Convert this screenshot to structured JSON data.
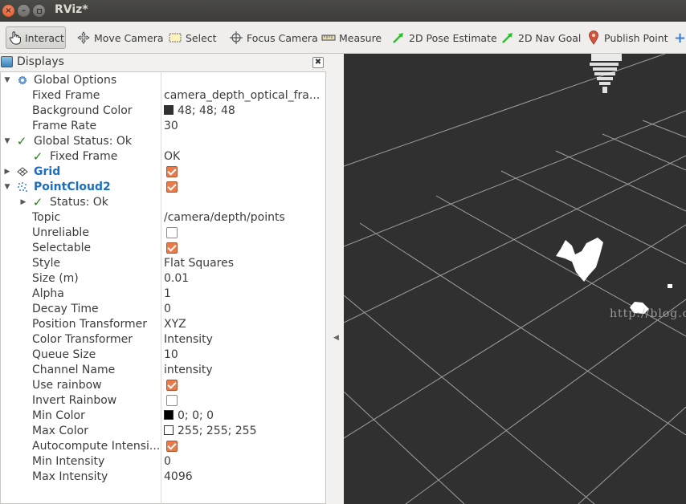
{
  "window": {
    "title": "RViz*"
  },
  "toolbar": {
    "interact": "Interact",
    "move_camera": "Move Camera",
    "select": "Select",
    "focus_camera": "Focus Camera",
    "measure": "Measure",
    "pose_estimate": "2D Pose Estimate",
    "nav_goal": "2D Nav Goal",
    "publish_point": "Publish Point"
  },
  "displays": {
    "title": "Displays",
    "global_options": "Global Options",
    "fixed_frame_label": "Fixed Frame",
    "fixed_frame_value": "camera_depth_optical_fra...",
    "background_color_label": "Background Color",
    "background_color_value": "48; 48; 48",
    "background_color_hex": "#303030",
    "frame_rate_label": "Frame Rate",
    "frame_rate_value": "30",
    "global_status": "Global Status: Ok",
    "status_fixed_frame_label": "Fixed Frame",
    "status_fixed_frame_value": "OK",
    "grid": {
      "label": "Grid",
      "enabled": true
    },
    "pointcloud": {
      "label": "PointCloud2",
      "enabled": true,
      "status": "Status: Ok",
      "topic_label": "Topic",
      "topic_value": "/camera/depth/points",
      "unreliable_label": "Unreliable",
      "unreliable_value": false,
      "selectable_label": "Selectable",
      "selectable_value": true,
      "style_label": "Style",
      "style_value": "Flat Squares",
      "size_label": "Size (m)",
      "size_value": "0.01",
      "alpha_label": "Alpha",
      "alpha_value": "1",
      "decay_label": "Decay Time",
      "decay_value": "0",
      "pos_transformer_label": "Position Transformer",
      "pos_transformer_value": "XYZ",
      "color_transformer_label": "Color Transformer",
      "color_transformer_value": "Intensity",
      "queue_label": "Queue Size",
      "queue_value": "10",
      "channel_label": "Channel Name",
      "channel_value": "intensity",
      "use_rainbow_label": "Use rainbow",
      "use_rainbow_value": true,
      "invert_rainbow_label": "Invert Rainbow",
      "invert_rainbow_value": false,
      "min_color_label": "Min Color",
      "min_color_value": "0; 0; 0",
      "min_color_hex": "#000000",
      "max_color_label": "Max Color",
      "max_color_value": "255; 255; 255",
      "max_color_hex": "#ffffff",
      "autocompute_label": "Autocompute Intensi...",
      "autocompute_value": true,
      "min_intensity_label": "Min Intensity",
      "min_intensity_value": "0",
      "max_intensity_label": "Max Intensity",
      "max_intensity_value": "4096"
    }
  },
  "view": {
    "watermark": "http://blog.csdn.net/"
  },
  "colors": {
    "accent_orange": "#e97a4a",
    "link_blue": "#1a6fc4",
    "check_green": "#2f7d21"
  }
}
